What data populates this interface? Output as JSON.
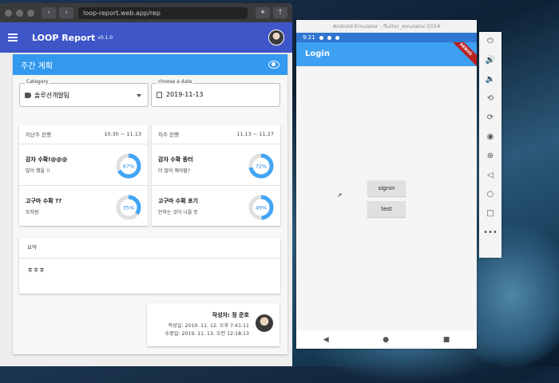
{
  "browser": {
    "url": "loop-report.web.app/rep",
    "app_title": "LOOP Report",
    "version": "v0.1.0"
  },
  "card": {
    "title": "주간 계획",
    "category_label": "Category",
    "category_value": "솔루션개발팀",
    "date_label": "choose a date",
    "date_value": "2019-11-13"
  },
  "last_week": {
    "label": "지난주 진행",
    "range": "10.30 ~ 11.13",
    "tasks": [
      {
        "name": "감자 수확!@@@",
        "desc": "많이 했을 !!",
        "percent": 67,
        "percent_label": "67%"
      },
      {
        "name": "고구마 수확 ??",
        "desc": "모자람",
        "percent": 35,
        "percent_label": "35%"
      }
    ]
  },
  "next_week": {
    "label": "차주 진행",
    "range": "11.13 ~ 11.27",
    "tasks": [
      {
        "name": "감자 수확 종터",
        "desc": "더 많이 해야할?",
        "percent": 72,
        "percent_label": "72%"
      },
      {
        "name": "고구마 수확 포기",
        "desc": "안하는 것이 나을 듯",
        "percent": 49,
        "percent_label": "49%"
      }
    ]
  },
  "summary": {
    "label": "요약",
    "text": "ㅎㅎㅎ"
  },
  "author": {
    "name": "작성자: 정 준호",
    "created": "작성일: 2019. 11. 12. 오후 7:41:11",
    "modified": "수정일: 2019. 11. 13. 오전 12:18:13"
  },
  "emulator": {
    "window_title": "Android Emulator - flutter_emulator:5554",
    "time": "9:21",
    "app_title": "Login",
    "ribbon": "DEBUG",
    "signin_label": "signin",
    "test_label": "test"
  },
  "colors": {
    "primary": "#3e56c8",
    "accent": "#3399ee",
    "ring": "#42a5f5",
    "ring_track": "#e0e0e0"
  }
}
